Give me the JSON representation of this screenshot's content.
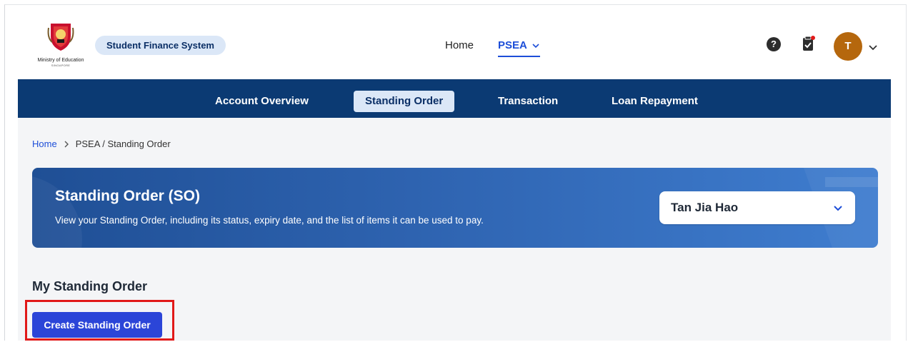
{
  "header": {
    "logo": {
      "ministry_name": "Ministry of Education",
      "ministry_sub": "SINGAPORE",
      "crest_icon": "ministry-crest-icon"
    },
    "system_badge": "Student Finance System",
    "nav": {
      "home": "Home",
      "psea": "PSEA"
    },
    "icons": {
      "help": "help-icon",
      "clipboard": "clipboard-notification-icon"
    },
    "avatar_initial": "T"
  },
  "subnav": {
    "items": [
      {
        "label": "Account Overview",
        "active": false
      },
      {
        "label": "Standing Order",
        "active": true
      },
      {
        "label": "Transaction",
        "active": false
      },
      {
        "label": "Loan Repayment",
        "active": false
      }
    ]
  },
  "breadcrumb": {
    "home": "Home",
    "current": "PSEA / Standing Order"
  },
  "banner": {
    "title": "Standing Order (SO)",
    "description": "View your Standing Order, including its status, expiry date, and the list of items it can be used to pay.",
    "student_select": "Tan Jia Hao"
  },
  "main": {
    "section_title": "My Standing Order",
    "create_button": "Create Standing Order"
  },
  "colors": {
    "nav_bar": "#0b3a73",
    "accent_blue": "#1d4ed8",
    "button_blue": "#2b45d8",
    "badge_bg": "#dbe7f7",
    "avatar": "#b5670d",
    "highlight_red": "#e11919"
  }
}
